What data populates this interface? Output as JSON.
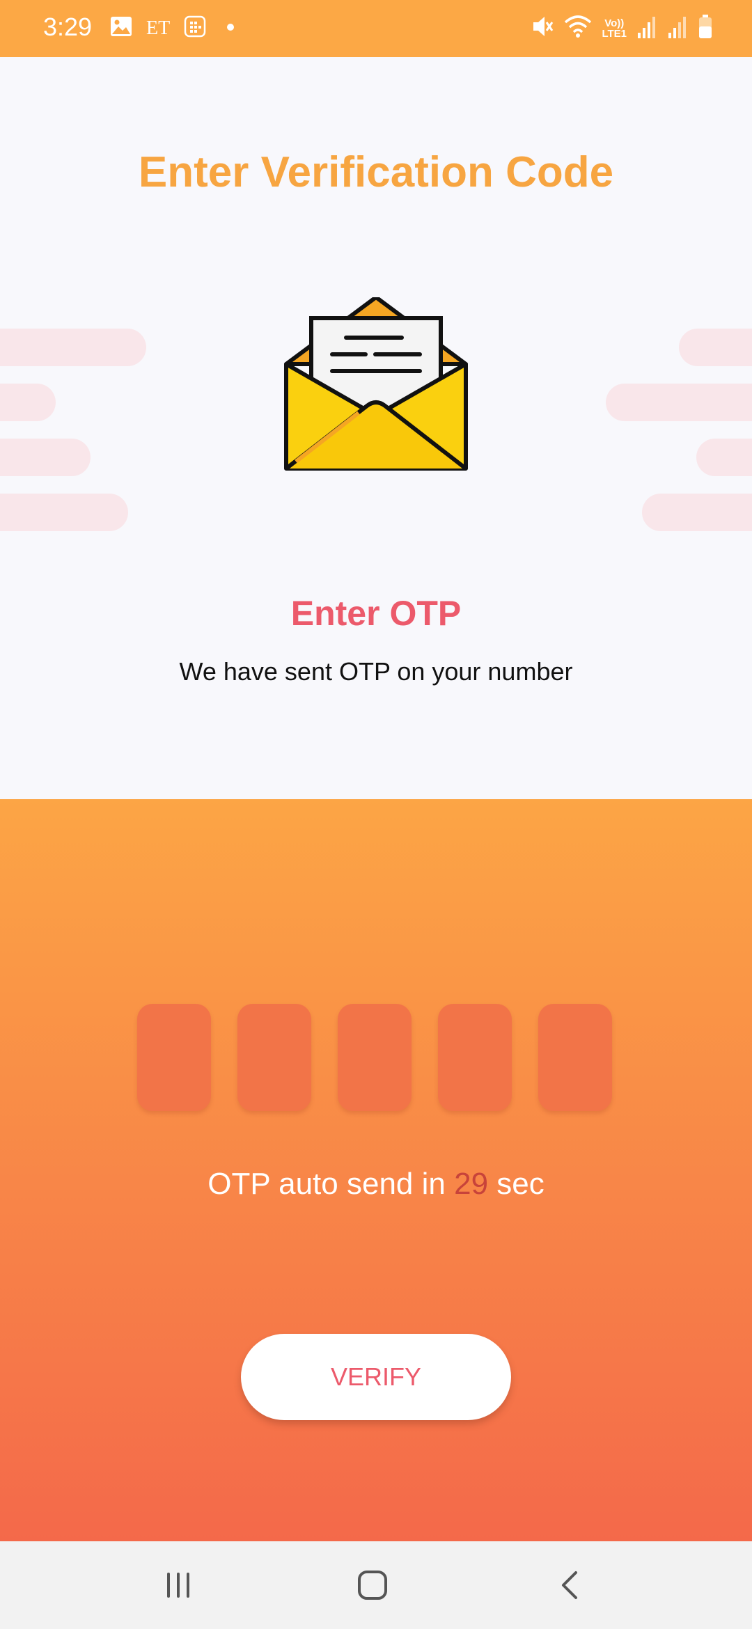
{
  "status_bar": {
    "time": "3:29",
    "carrier_text": "ET",
    "network_label_top": "Vo))",
    "network_label_bottom": "LTE1",
    "icons": [
      "gallery-icon",
      "calendar-icon",
      "dot-icon",
      "mute-icon",
      "wifi-icon",
      "signal-icon",
      "signal-icon",
      "battery-icon"
    ]
  },
  "header": {
    "title": "Enter Verification Code"
  },
  "illustration": {
    "icon": "envelope-letter-icon"
  },
  "message": {
    "title": "Enter OTP",
    "subtitle": "We have sent OTP on your number"
  },
  "otp": {
    "digits": [
      "",
      "",
      "",
      "",
      ""
    ],
    "timer_prefix": "OTP auto send in",
    "timer_count": "29",
    "timer_suffix": "sec"
  },
  "verify_button": {
    "label": "VERIFY"
  },
  "nav_bar": {
    "items": [
      "recent-apps-icon",
      "home-icon",
      "back-icon"
    ]
  },
  "colors": {
    "status_bar": "#FCA845",
    "title": "#F7A541",
    "accent_pink": "#EC5A6B",
    "gradient_top": "#FCA545",
    "gradient_bottom": "#F4694A",
    "otp_box": "#F27448",
    "timer_count": "#C8433A"
  }
}
